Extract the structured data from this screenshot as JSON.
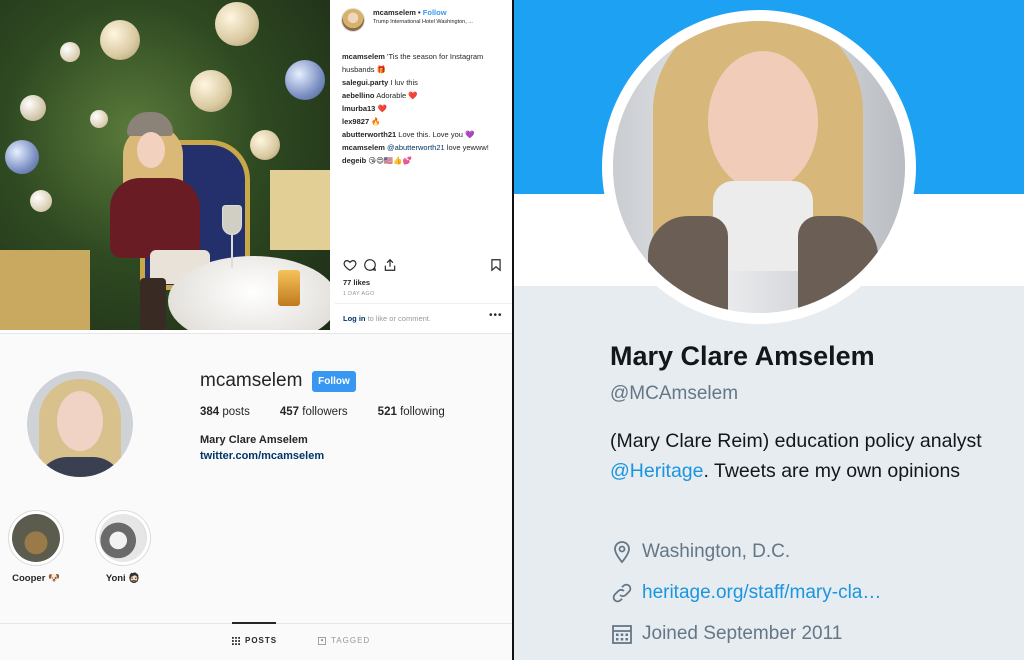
{
  "instagram_post": {
    "username": "mcamselem",
    "follow_label": "Follow",
    "separator": "•",
    "location": "Trump International Hotel Washington, ...",
    "comments": [
      {
        "user": "mcamselem",
        "text": "'Tis the season for Instagram husbands 🎁"
      },
      {
        "user": "salegui.party",
        "text": "I luv this"
      },
      {
        "user": "aebellino",
        "text": "Adorable ❤️"
      },
      {
        "user": "lmurba13",
        "text": "❤️"
      },
      {
        "user": "lex9827",
        "text": "🔥"
      },
      {
        "user": "abutterworth21",
        "text": "Love this. Love you 💜"
      },
      {
        "user": "mcamselem",
        "mention": "@abutterworth21",
        "text": "love yewww!"
      },
      {
        "user": "degeib",
        "text": "😘😍🇺🇸👍💕"
      }
    ],
    "likes": "77 likes",
    "time_ago": "1 DAY AGO",
    "login_link": "Log in",
    "login_rest": "to like or comment.",
    "more": "•••",
    "icons": [
      "heart-icon",
      "comment-icon",
      "share-icon",
      "bookmark-icon"
    ]
  },
  "instagram_profile": {
    "username": "mcamselem",
    "follow_label": "Follow",
    "posts_count": "384",
    "posts_label": "posts",
    "followers_count": "457",
    "followers_label": "followers",
    "following_count": "521",
    "following_label": "following",
    "full_name": "Mary Clare Amselem",
    "website": "twitter.com/mcamselem",
    "highlights": [
      {
        "label": "Cooper 🐶"
      },
      {
        "label": "Yoni 🧔🏻"
      }
    ],
    "tabs": [
      {
        "label": "POSTS",
        "active": true
      },
      {
        "label": "TAGGED",
        "active": false
      }
    ]
  },
  "twitter_profile": {
    "name": "Mary Clare Amselem",
    "handle": "@MCAmselem",
    "bio_pre": "(Mary Clare Reim) education policy analyst ",
    "bio_mention": "@Heritage",
    "bio_post": ". Tweets are my own opinions",
    "location": "Washington, D.C.",
    "website": "heritage.org/staff/mary-cla…",
    "joined": "Joined September 2011",
    "colors": {
      "banner": "#1da1f2",
      "link": "#1b95e0",
      "background": "#e6ecf0"
    }
  }
}
